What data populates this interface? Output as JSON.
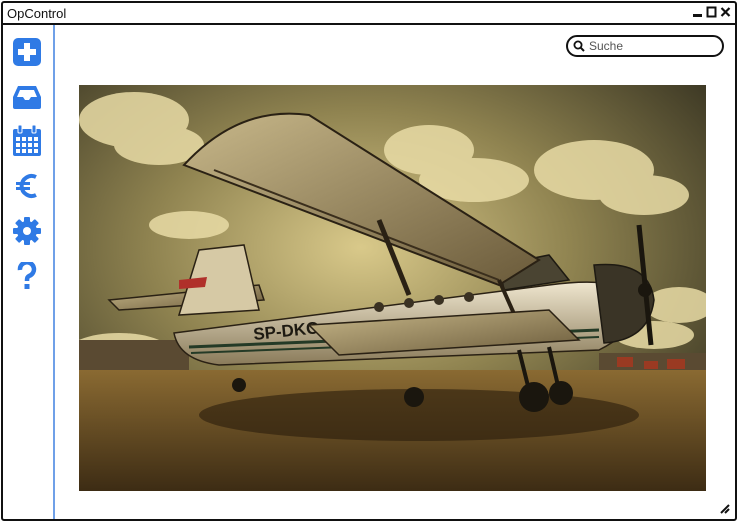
{
  "window": {
    "title": "OpControl"
  },
  "window_controls": [
    {
      "icon": "minimize-icon"
    },
    {
      "icon": "maximize-icon"
    },
    {
      "icon": "close-icon"
    }
  ],
  "sidebar": {
    "items": [
      {
        "icon": "plus-square-icon",
        "color": "#2f7ae5"
      },
      {
        "icon": "inbox-icon",
        "color": "#2f7ae5"
      },
      {
        "icon": "calendar-icon",
        "color": "#2f7ae5"
      },
      {
        "icon": "euro-icon",
        "color": "#2f7ae5",
        "glyph": "€"
      },
      {
        "icon": "gear-icon",
        "color": "#2f7ae5"
      },
      {
        "icon": "help-icon",
        "color": "#2f7ae5",
        "glyph": "?"
      }
    ]
  },
  "search": {
    "placeholder": "Suche",
    "value": ""
  },
  "main": {
    "image": {
      "aircraft_registration": "SP-DKO"
    }
  }
}
